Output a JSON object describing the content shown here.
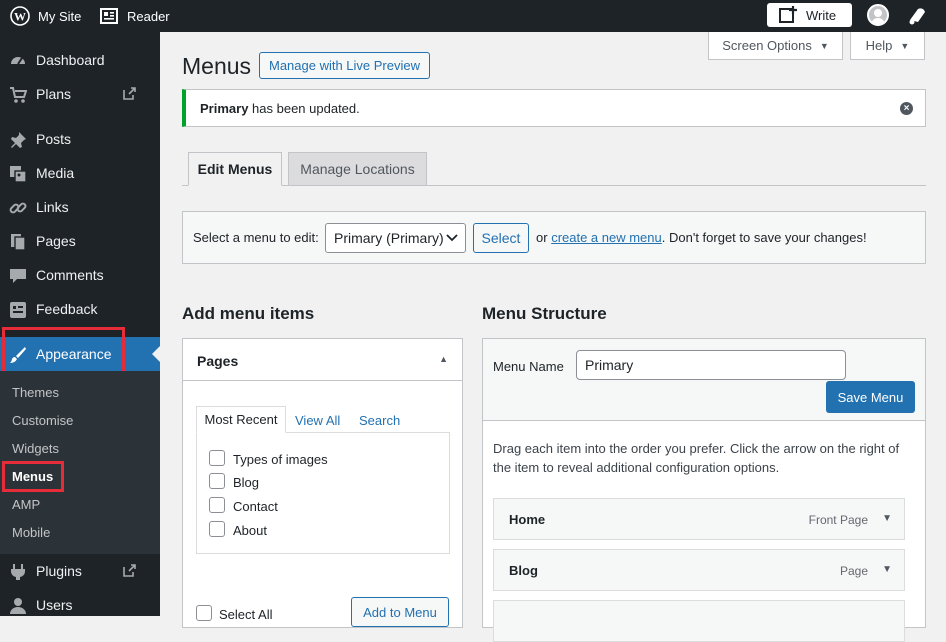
{
  "topbar": {
    "site_label": "My Site",
    "reader_label": "Reader",
    "write_label": "Write",
    "icons": [
      "wordpress-icon",
      "reader-icon",
      "write-icon",
      "avatar",
      "notifications-icon"
    ]
  },
  "sidebar": {
    "items": [
      {
        "label": "Dashboard",
        "icon": "dashboard-icon"
      },
      {
        "label": "Plans",
        "icon": "cart-icon"
      },
      {
        "label": "Posts",
        "icon": "pin-icon"
      },
      {
        "label": "Media",
        "icon": "media-icon"
      },
      {
        "label": "Links",
        "icon": "link-icon"
      },
      {
        "label": "Pages",
        "icon": "pages-icon"
      },
      {
        "label": "Comments",
        "icon": "comments-icon"
      },
      {
        "label": "Feedback",
        "icon": "feedback-icon"
      },
      {
        "label": "Appearance",
        "icon": "brush-icon"
      },
      {
        "label": "Plugins",
        "icon": "plugins-icon"
      },
      {
        "label": "Users",
        "icon": "users-icon"
      }
    ],
    "appearance_sub": [
      "Themes",
      "Customise",
      "Widgets",
      "Menus",
      "AMP",
      "Mobile"
    ]
  },
  "header": {
    "screen_options": "Screen Options",
    "help": "Help",
    "title": "Menus",
    "live_preview": "Manage with Live Preview"
  },
  "notice": {
    "bold": "Primary",
    "text": "has been updated."
  },
  "tabs": [
    "Edit Menus",
    "Manage Locations"
  ],
  "select_bar": {
    "label": "Select a menu to edit:",
    "selected": "Primary (Primary)",
    "button": "Select",
    "or": "or",
    "link": "create a new menu",
    "after": ". Don't forget to save your changes!"
  },
  "add_items": {
    "heading": "Add menu items",
    "panel_title": "Pages",
    "subtabs": [
      "Most Recent",
      "View All",
      "Search"
    ],
    "pages": [
      "Types of images",
      "Blog",
      "Contact",
      "About"
    ],
    "select_all": "Select All",
    "add_button": "Add to Menu"
  },
  "structure": {
    "heading": "Menu Structure",
    "name_label": "Menu Name",
    "name_value": "Primary",
    "save": "Save Menu",
    "instructions_1": "Drag each item into the order you prefer. Click the arrow on the right of",
    "instructions_2": "the item to reveal additional configuration options.",
    "items": [
      {
        "title": "Home",
        "type": "Front Page"
      },
      {
        "title": "Blog",
        "type": "Page"
      }
    ]
  },
  "colors": {
    "accent": "#2271b1",
    "highlight_box": "#e52d3a",
    "success": "#00a32a",
    "sidebar_bg": "#1d2327"
  }
}
